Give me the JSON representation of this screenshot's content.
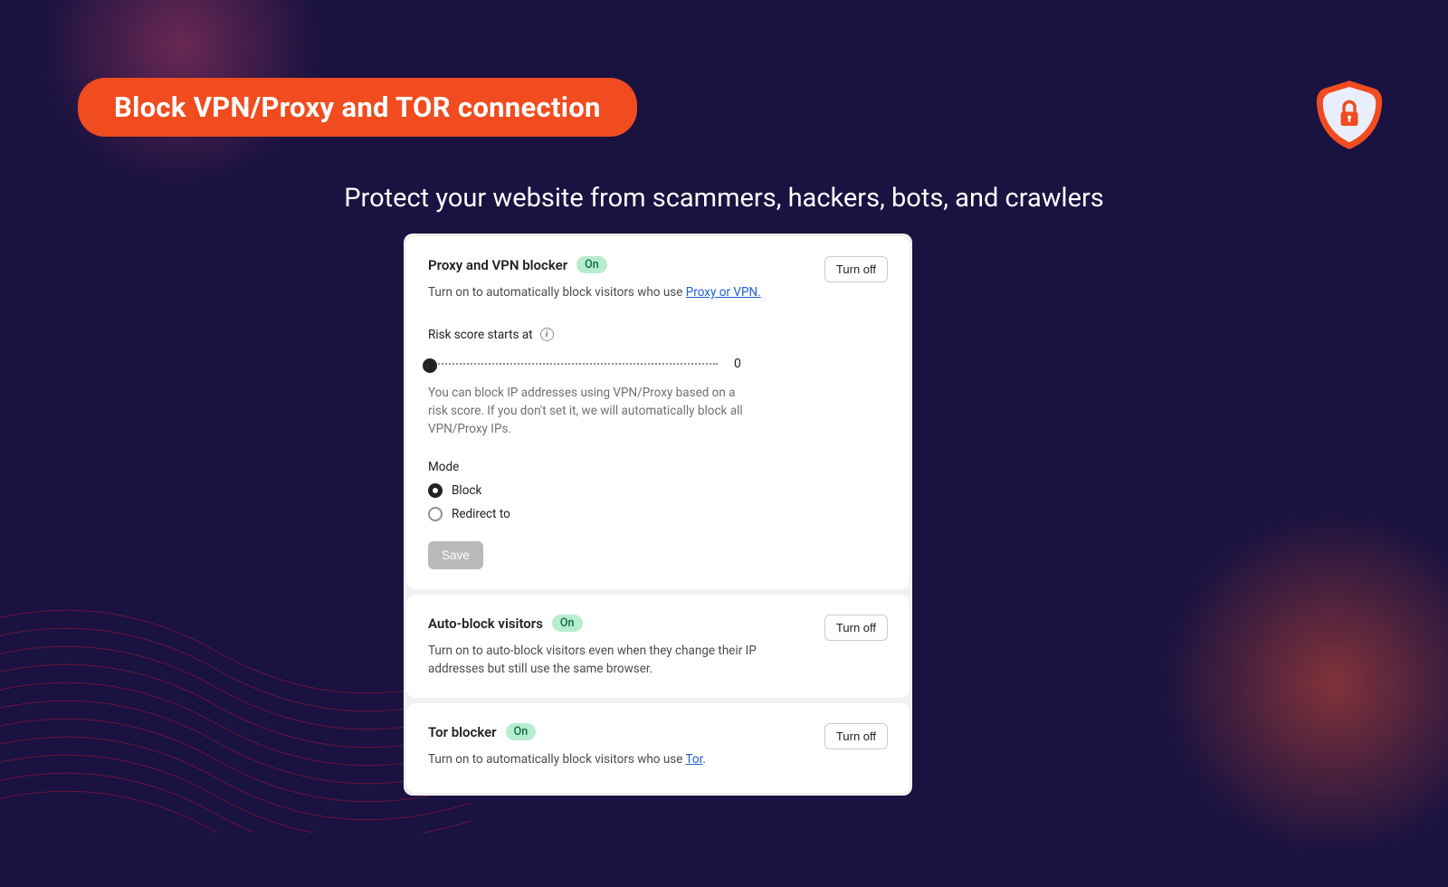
{
  "header": {
    "title": "Block VPN/Proxy and TOR connection"
  },
  "subtitle": "Protect your website from scammers, hackers, bots, and crawlers",
  "cards": {
    "proxy": {
      "title": "Proxy and VPN blocker",
      "badge": "On",
      "turn_off": "Turn off",
      "desc_prefix": "Turn on to automatically block visitors who use ",
      "link_text": "Proxy or VPN.",
      "risk_label": "Risk score starts at",
      "slider_value": "0",
      "risk_help": "You can block IP addresses using VPN/Proxy based on a risk score. If you don't set it, we will automatically block all VPN/Proxy IPs.",
      "mode_label": "Mode",
      "mode_block": "Block",
      "mode_redirect": "Redirect to",
      "save_label": "Save"
    },
    "autoblock": {
      "title": "Auto-block visitors",
      "badge": "On",
      "turn_off": "Turn off",
      "desc": "Turn on to auto-block visitors even when they change their IP addresses but still use the same browser."
    },
    "tor": {
      "title": "Tor blocker",
      "badge": "On",
      "turn_off": "Turn off",
      "desc_prefix": "Turn on to automatically block visitors who use ",
      "link_text": "Tor",
      "desc_suffix": "."
    }
  }
}
